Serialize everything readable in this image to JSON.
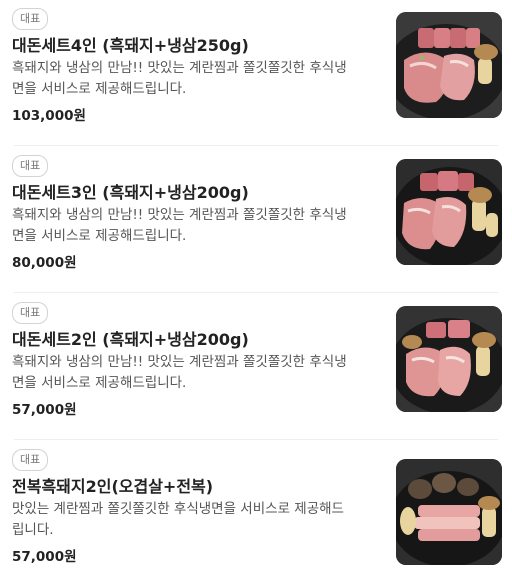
{
  "items": [
    {
      "badge": "대표",
      "title": "대돈세트4인 (흑돼지+냉삼250g)",
      "desc_line1": "흑돼지와 냉삼의 만남!! 맛있는 계란찜과 쫄깃쫄깃한 후식냉",
      "desc_line2": "면을 서비스로 제공해드립니다.",
      "price": "103,000원",
      "image_icon": "pork-platter-photo"
    },
    {
      "badge": "대표",
      "title": "대돈세트3인 (흑돼지+냉삼200g)",
      "desc_line1": "흑돼지와 냉삼의 만남!! 맛있는 계란찜과 쫄깃쫄깃한 후식냉",
      "desc_line2": "면을 서비스로 제공해드립니다.",
      "price": "80,000원",
      "image_icon": "pork-platter-photo"
    },
    {
      "badge": "대표",
      "title": "대돈세트2인 (흑돼지+냉삼200g)",
      "desc_line1": "흑돼지와 냉삼의 만남!! 맛있는 계란찜과 쫄깃쫄깃한 후식냉",
      "desc_line2": "면을 서비스로 제공해드립니다.",
      "price": "57,000원",
      "image_icon": "pork-platter-photo"
    },
    {
      "badge": "대표",
      "title": "전복흑돼지2인(오겹살+전복)",
      "desc_line1": "맛있는 계란찜과 쫄깃쫄깃한 후식냉면을 서비스로 제공해드",
      "desc_line2": "립니다.",
      "price": "57,000원",
      "image_icon": "pork-abalone-platter-photo"
    }
  ],
  "colors": {
    "title": "#222222",
    "description": "#555555",
    "badge_border": "#d3d3d3",
    "divider": "#efefef"
  }
}
